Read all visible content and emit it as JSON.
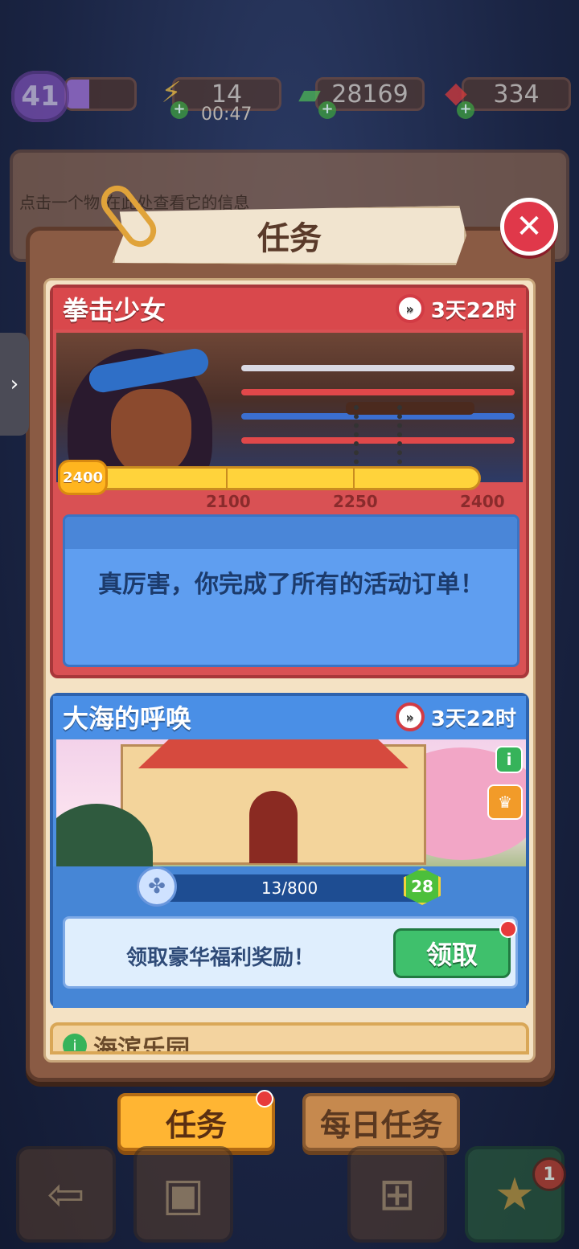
{
  "resources": {
    "level": "41",
    "energy": "14",
    "energy_timer": "00:47",
    "cash": "28169",
    "gems": "334"
  },
  "info_panel": {
    "text": "点击一个物     在此处查看它的信息"
  },
  "modal": {
    "title": "任务",
    "close_icon": "✕"
  },
  "events": [
    {
      "title": "拳击少女",
      "timer": "3天22时",
      "score_badge": "2400",
      "progress_ticks": [
        "2100",
        "2250",
        "2400"
      ],
      "progress_fraction": 1.0,
      "completion_message": "真厉害，你完成了所有的活动订单！"
    },
    {
      "title": "大海的呼唤",
      "timer": "3天22时",
      "progress_text": "13/800",
      "level": "28",
      "claim_text": "领取豪华福利奖励！",
      "claim_button": "领取"
    },
    {
      "title": "海滨乐园"
    }
  ],
  "tabs": {
    "tasks": "任务",
    "daily": "每日任务"
  },
  "nav": {
    "badge_count": "1"
  },
  "colors": {
    "card1": "#d95154",
    "card2": "#4d8fe0",
    "claim_button": "#3fc06c",
    "tab_active": "#ffb533"
  }
}
